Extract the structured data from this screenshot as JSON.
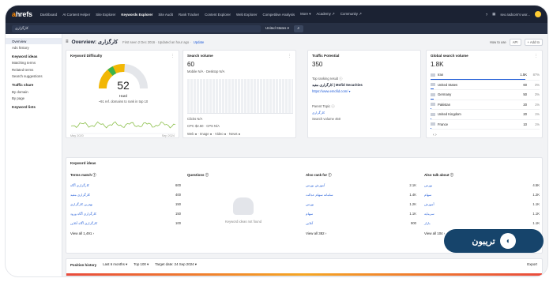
{
  "nav": {
    "logo_a": "a",
    "logo_rest": "hrefs",
    "items": [
      "Dashboard",
      "AI Content Helper",
      "Site Explorer",
      "Keywords Explorer",
      "Site Audit",
      "Rank Tracker",
      "Content Explorer",
      "Web Explorer",
      "Competitive Analysis",
      "More ▾",
      "Academy ↗",
      "Community ↗"
    ],
    "account": "seo.radcom's wor..."
  },
  "search": {
    "query": "کارگزاری",
    "country": "United States ▾"
  },
  "sidebar": {
    "items_top": [
      "Overview",
      "Ads history"
    ],
    "group1": "Keyword ideas",
    "group1_items": [
      "Matching terms",
      "Related terms",
      "Search suggestions"
    ],
    "group2": "Traffic share",
    "group2_items": [
      "By domain",
      "By page"
    ],
    "group3": "Keyword lists"
  },
  "overview": {
    "title": "Overview: کارگزاری",
    "meta": "First seen 2 Dec 2016 · Updated an hour ago ·",
    "update": "Update",
    "howto": "How to use",
    "api": "API",
    "add": "+ Add to"
  },
  "kd": {
    "title": "Keyword Difficulty",
    "value": "52",
    "label": "Hard",
    "note": "~91 ref. domains to rank in top 10",
    "from": "May 2020",
    "to": "Sep 2024",
    "gauge_fraction": 0.52
  },
  "sv": {
    "title": "Search volume",
    "value": "60",
    "devices": "Mobile N/A · Desktop N/A",
    "clicks": "Clicks N/A",
    "cpc": "CPC $2.50 · CPS N/A",
    "serp": "Web ● · Image ● · Video ● · News ●"
  },
  "tp": {
    "title": "Traffic Potential",
    "value": "350",
    "top_label": "Top ranking result ⓘ",
    "top_title": "کارگزاری مفید | Mofid Securities",
    "top_url": "https://www.emofid.com/ ▾",
    "parent_label": "Parent Topic ⓘ",
    "parent_kw": "کارگزاری",
    "parent_sv": "Search volume 450"
  },
  "gsv": {
    "title": "Global search volume",
    "value": "1.8K",
    "rows": [
      {
        "country": "Iran",
        "value": "1.5K",
        "pct": "87%",
        "share": 0.87
      },
      {
        "country": "United States",
        "value": "60",
        "pct": "3%",
        "share": 0.03
      },
      {
        "country": "Germany",
        "value": "50",
        "pct": "3%",
        "share": 0.03
      },
      {
        "country": "Pakistan",
        "value": "20",
        "pct": "1%",
        "share": 0.01
      },
      {
        "country": "United Kingdom",
        "value": "20",
        "pct": "1%",
        "share": 0.01
      },
      {
        "country": "France",
        "value": "10",
        "pct": "1%",
        "share": 0.01
      }
    ],
    "pager": "‹   ›"
  },
  "ideas": {
    "title": "Keyword ideas",
    "col1": "Terms match ⓘ",
    "col2": "Questions ⓘ",
    "col3": "Also rank for ⓘ",
    "col4": "Also talk about ⓘ",
    "terms": [
      {
        "k": "کارگزاری آگاه",
        "v": "600"
      },
      {
        "k": "کارگزاری مفید",
        "v": "400"
      },
      {
        "k": "بهترین کارگزاری",
        "v": "150"
      },
      {
        "k": "کارگزاری آگاه ورود",
        "v": "150"
      },
      {
        "k": "کارگزاری آگاه آنلاین",
        "v": "100"
      }
    ],
    "terms_all": "View all 1,491 ›",
    "questions_empty": "Keyword ideas not found",
    "also_rank": [
      {
        "k": "آموزش بورس",
        "v": "2.1K"
      },
      {
        "k": "سامانه سهام عدالت",
        "v": "1.4K"
      },
      {
        "k": "بورس",
        "v": "1.2K"
      },
      {
        "k": "سهام",
        "v": "1.1K"
      },
      {
        "k": "آنلاین",
        "v": "900"
      }
    ],
    "also_rank_all": "View all 382 ›",
    "also_talk": [
      {
        "k": "بورس",
        "v": "4.5K"
      },
      {
        "k": "سهام",
        "v": "1.2K"
      },
      {
        "k": "آموزش",
        "v": "1.1K"
      },
      {
        "k": "سرمایه",
        "v": "1.1K"
      },
      {
        "k": "بازار",
        "v": "1.1K"
      }
    ],
    "also_talk_all": "View all 104 ›"
  },
  "pos": {
    "title": "Position history",
    "range": "Last 6 months ▾",
    "top": "Top 100 ▾",
    "target": "Target date: 24 Sep 2024 ▾",
    "export": "Export"
  },
  "watermark": {
    "text": "تریبون"
  }
}
